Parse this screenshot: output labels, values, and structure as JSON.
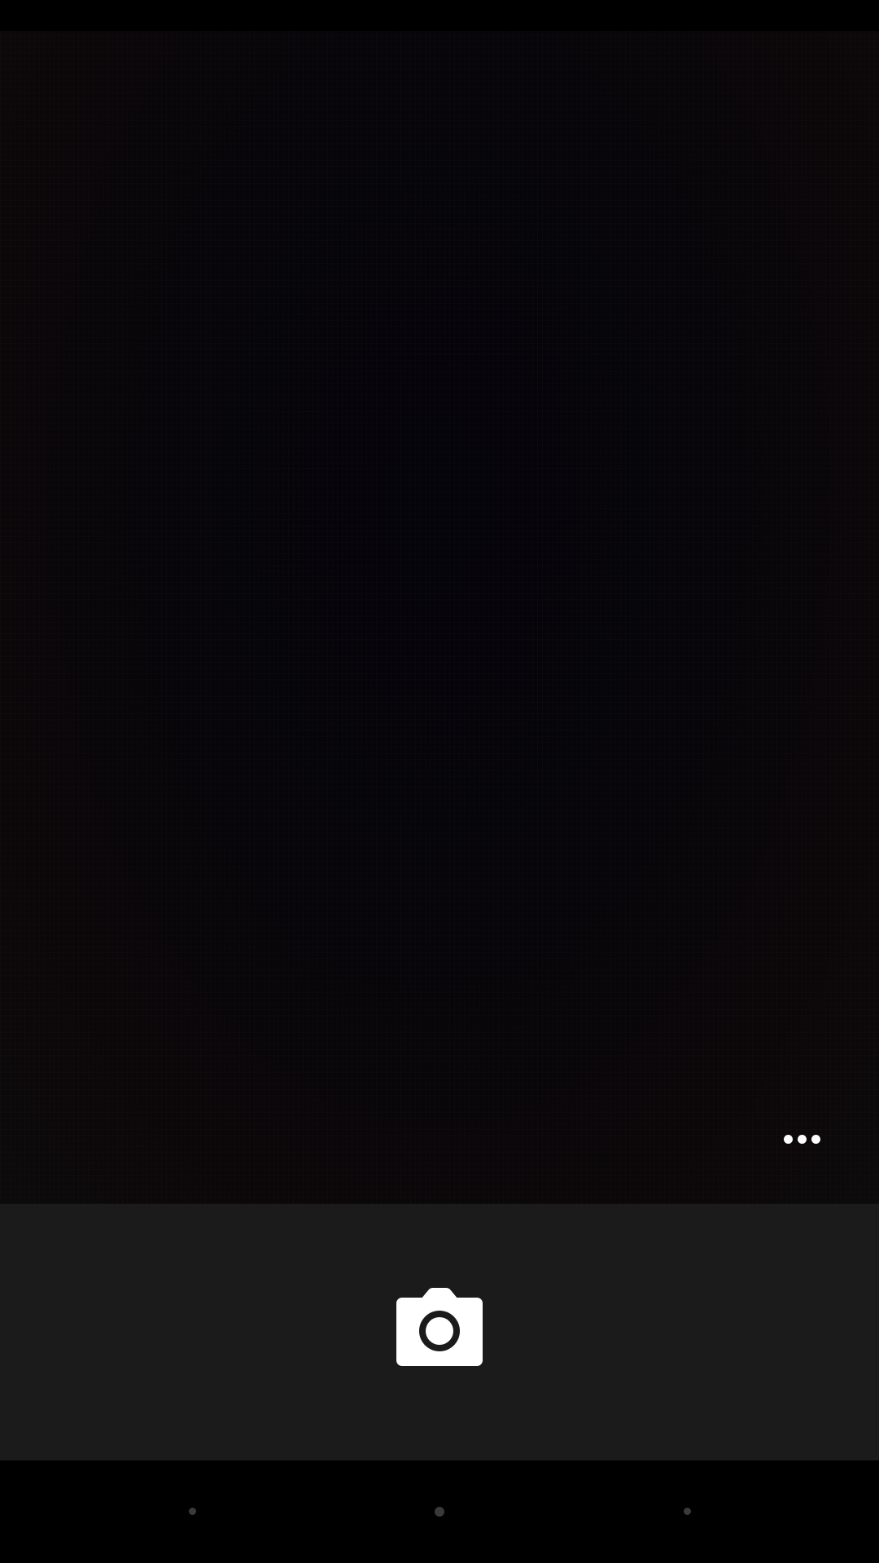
{
  "app": {
    "screen": "camera"
  },
  "colors": {
    "viewfinder_background": "#060509",
    "control_bar_background": "#1b1b1b",
    "icon_color": "#ffffff",
    "nav_dot_color": "#3a3a3a"
  },
  "viewfinder": {
    "more_options_icon": "more-horizontal-icon"
  },
  "controls": {
    "shutter_icon": "camera-icon"
  },
  "navigation": {
    "back_icon": "nav-back-dot-icon",
    "home_icon": "nav-home-dot-icon",
    "recents_icon": "nav-recents-dot-icon"
  }
}
